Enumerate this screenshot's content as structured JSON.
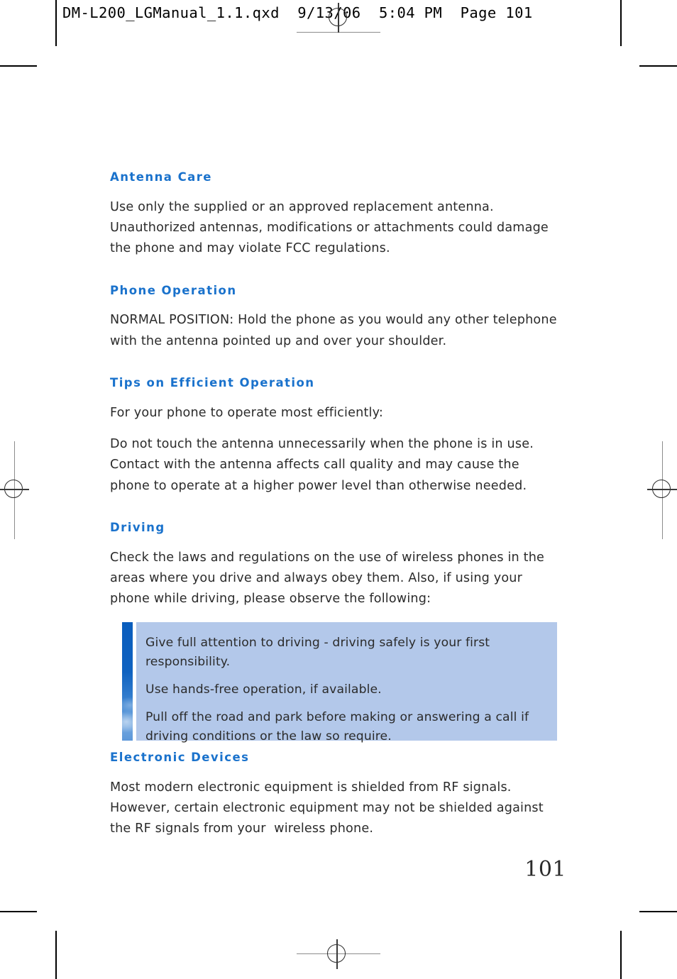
{
  "print_header": "DM-L200_LGManual_1.1.qxd  9/13/06  5:04 PM  Page 101",
  "colors": {
    "heading_blue": "#1a72cc",
    "body_text": "#2b2b2b",
    "callout_background": "#b3c8ea",
    "callout_bar_blue": "#0a5dbd",
    "page_background": "#ffffff"
  },
  "sections": [
    {
      "heading": "Antenna Care",
      "paragraphs": [
        "Use only the supplied or an approved replacement antenna.\nUnauthorized antennas, modifications or attachments could damage\nthe phone and may violate FCC regulations."
      ]
    },
    {
      "heading": "Phone Operation",
      "paragraphs": [
        "NORMAL POSITION: Hold the phone as you would any other telephone\nwith the antenna pointed up and over your shoulder."
      ]
    },
    {
      "heading": "Tips on Efficient Operation",
      "paragraphs": [
        "For your phone to operate most efficiently:",
        "Do not touch the antenna unnecessarily when the phone is in use.\nContact with the antenna affects call quality and may cause the\nphone to operate at a higher power level than otherwise needed."
      ]
    },
    {
      "heading": "Driving",
      "paragraphs": [
        "Check the laws and regulations on the use of wireless phones in the\nareas where you drive and always obey them. Also, if using your\nphone while driving, please observe the following:"
      ]
    }
  ],
  "callout": {
    "items": [
      "Give full attention to driving - driving safely is your first\nresponsibility.",
      "Use hands-free operation, if available.",
      "Pull off the road and park before making or answering a call if\ndriving conditions or the law so require."
    ]
  },
  "closing_section": {
    "heading": "Electronic Devices",
    "paragraphs": [
      "Most modern electronic equipment is shielded from RF signals.\nHowever, certain electronic equipment may not be shielded against\nthe RF signals from your  wireless phone."
    ]
  },
  "page_number": "101"
}
